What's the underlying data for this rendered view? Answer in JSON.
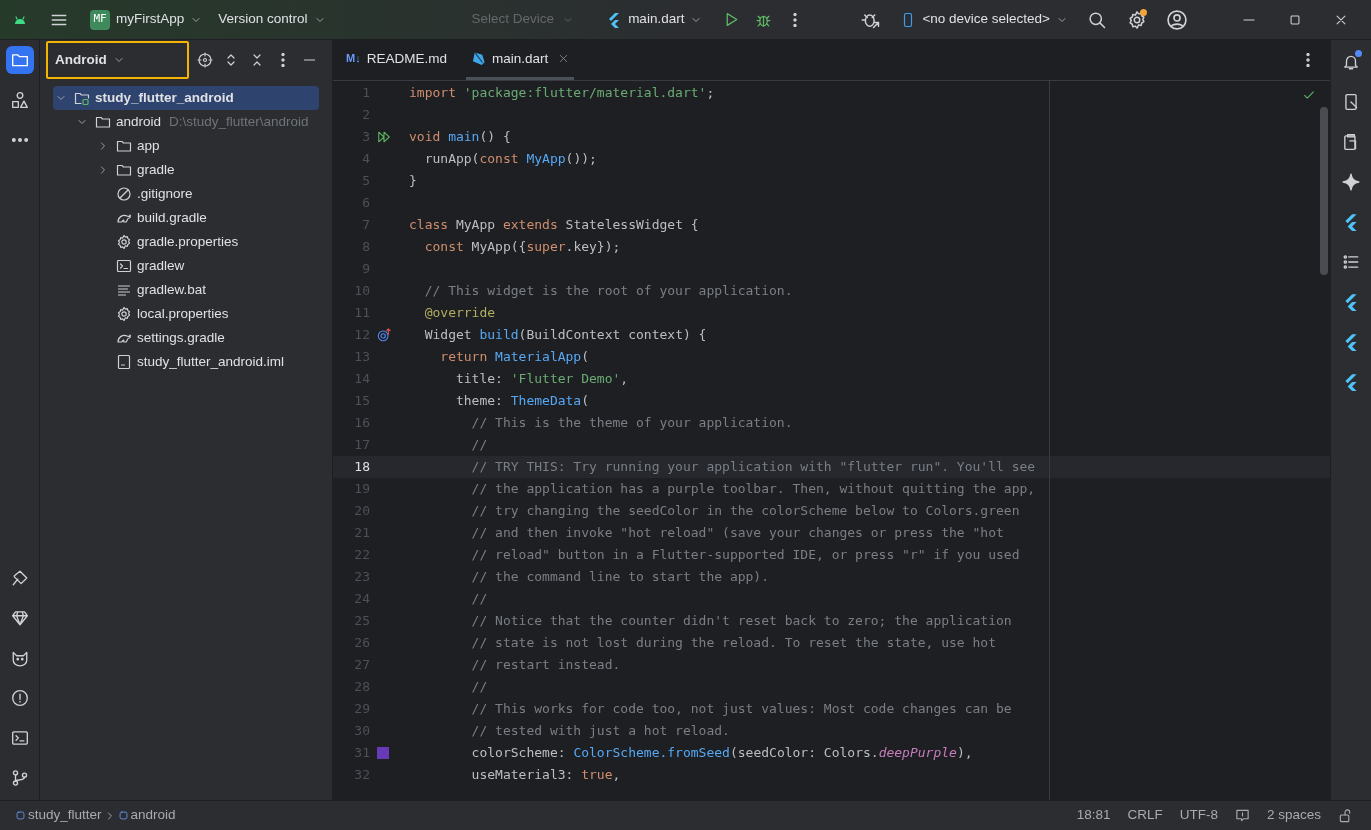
{
  "title_bar": {
    "project_badge": "MF",
    "project": "myFirstApp",
    "vcs": "Version control",
    "device_placeholder": "Select Device",
    "run_config": "main.dart",
    "device": "<no device selected>",
    "settings_badge": true
  },
  "tool_strip_left": {
    "top": [
      {
        "kind": "project",
        "selected": true
      },
      {
        "kind": "structure",
        "selected": false
      },
      {
        "kind": "more",
        "selected": false
      }
    ],
    "bottom": [
      {
        "kind": "build"
      },
      {
        "kind": "gem"
      },
      {
        "kind": "cat"
      },
      {
        "kind": "problems"
      },
      {
        "kind": "terminal"
      },
      {
        "kind": "git"
      }
    ]
  },
  "project_panel": {
    "view": "Android",
    "view_focused": true,
    "tree": [
      {
        "label": "study_flutter_android",
        "kind": "module",
        "expanded": true,
        "selected": true,
        "children": [
          {
            "label": "android",
            "hint": "D:\\study_flutter\\android",
            "kind": "folder",
            "expanded": true,
            "selected": false,
            "children": [
              {
                "label": "app",
                "kind": "folder",
                "expanded": false,
                "selected": false
              },
              {
                "label": "gradle",
                "kind": "folder",
                "expanded": false,
                "selected": false
              },
              {
                "label": ".gitignore",
                "kind": "ignore",
                "selected": false
              },
              {
                "label": "build.gradle",
                "kind": "gradle",
                "selected": false
              },
              {
                "label": "gradle.properties",
                "kind": "settings",
                "selected": false
              },
              {
                "label": "gradlew",
                "kind": "terminal",
                "selected": false
              },
              {
                "label": "gradlew.bat",
                "kind": "text",
                "selected": false
              },
              {
                "label": "local.properties",
                "kind": "settings",
                "selected": false
              },
              {
                "label": "settings.gradle",
                "kind": "gradle",
                "selected": false
              },
              {
                "label": "study_flutter_android.iml",
                "kind": "iml",
                "selected": false
              }
            ]
          }
        ]
      }
    ]
  },
  "editor": {
    "tabs": [
      {
        "label": "README.md",
        "kind": "markdown",
        "icon_text": "M↓",
        "selected": false
      },
      {
        "label": "main.dart",
        "kind": "dart",
        "selected": true,
        "closable": true
      }
    ],
    "lines": [
      {
        "number": "1",
        "current": false,
        "tokens": [
          {
            "kind": "kw",
            "text": "import"
          },
          {
            "kind": "str",
            "text": " 'package:flutter/material.dart'"
          },
          {
            "kind": "p",
            "text": ";"
          }
        ]
      },
      {
        "number": "2",
        "current": false
      },
      {
        "number": "3",
        "current": false,
        "gutter": {
          "kind": "run"
        },
        "tokens": [
          {
            "kind": "kw",
            "text": "void"
          },
          {
            "kind": "fn",
            "text": " main"
          },
          {
            "kind": "p",
            "text": "() {"
          }
        ]
      },
      {
        "number": "4",
        "current": false,
        "tokens": [
          {
            "kind": "p",
            "text": "  runApp("
          },
          {
            "kind": "kw",
            "text": "const"
          },
          {
            "kind": "type",
            "text": " MyApp"
          },
          {
            "kind": "p",
            "text": "());"
          }
        ]
      },
      {
        "number": "5",
        "current": false,
        "tokens": [
          {
            "kind": "p",
            "text": "}"
          }
        ]
      },
      {
        "number": "6",
        "current": false
      },
      {
        "number": "7",
        "current": false,
        "tokens": [
          {
            "kind": "kw",
            "text": "class"
          },
          {
            "kind": "p",
            "text": " MyApp "
          },
          {
            "kind": "kw",
            "text": "extends"
          },
          {
            "kind": "p",
            "text": " StatelessWidget {"
          }
        ]
      },
      {
        "number": "8",
        "current": false,
        "tokens": [
          {
            "kind": "kw",
            "text": "  const"
          },
          {
            "kind": "p",
            "text": " MyApp({"
          },
          {
            "kind": "kw",
            "text": "super"
          },
          {
            "kind": "p",
            "text": ".key});"
          }
        ]
      },
      {
        "number": "9",
        "current": false
      },
      {
        "number": "10",
        "current": false,
        "tokens": [
          {
            "kind": "cmt",
            "text": "  // This widget is the root of your application."
          }
        ]
      },
      {
        "number": "11",
        "current": false,
        "tokens": [
          {
            "kind": "ann",
            "text": "  @override"
          }
        ]
      },
      {
        "number": "12",
        "current": false,
        "gutter": {
          "kind": "override"
        },
        "tokens": [
          {
            "kind": "p",
            "text": "  Widget "
          },
          {
            "kind": "fn",
            "text": "build"
          },
          {
            "kind": "p",
            "text": "(BuildContext context) {"
          }
        ]
      },
      {
        "number": "13",
        "current": false,
        "tokens": [
          {
            "kind": "kw",
            "text": "    return"
          },
          {
            "kind": "type",
            "text": " MaterialApp"
          },
          {
            "kind": "p",
            "text": "("
          }
        ]
      },
      {
        "number": "14",
        "current": false,
        "tokens": [
          {
            "kind": "p",
            "text": "      title: "
          },
          {
            "kind": "str",
            "text": "'Flutter Demo'"
          },
          {
            "kind": "p",
            "text": ","
          }
        ]
      },
      {
        "number": "15",
        "current": false,
        "tokens": [
          {
            "kind": "p",
            "text": "      theme: "
          },
          {
            "kind": "type",
            "text": "ThemeData"
          },
          {
            "kind": "p",
            "text": "("
          }
        ]
      },
      {
        "number": "16",
        "current": false,
        "tokens": [
          {
            "kind": "cmt",
            "text": "        // This is the theme of your application."
          }
        ]
      },
      {
        "number": "17",
        "current": false,
        "tokens": [
          {
            "kind": "cmt",
            "text": "        //"
          }
        ]
      },
      {
        "number": "18",
        "current": true,
        "tokens": [
          {
            "kind": "cmt",
            "text": "        // TRY THIS: Try running your application with \"flutter run\". You'll see"
          }
        ]
      },
      {
        "number": "19",
        "current": false,
        "tokens": [
          {
            "kind": "cmt",
            "text": "        // the application has a purple toolbar. Then, without quitting the app,"
          }
        ]
      },
      {
        "number": "20",
        "current": false,
        "tokens": [
          {
            "kind": "cmt",
            "text": "        // try changing the seedColor in the colorScheme below to Colors.green"
          }
        ]
      },
      {
        "number": "21",
        "current": false,
        "tokens": [
          {
            "kind": "cmt",
            "text": "        // and then invoke \"hot reload\" (save your changes or press the \"hot"
          }
        ]
      },
      {
        "number": "22",
        "current": false,
        "tokens": [
          {
            "kind": "cmt",
            "text": "        // reload\" button in a Flutter-supported IDE, or press \"r\" if you used"
          }
        ]
      },
      {
        "number": "23",
        "current": false,
        "tokens": [
          {
            "kind": "cmt",
            "text": "        // the command line to start the app)."
          }
        ]
      },
      {
        "number": "24",
        "current": false,
        "tokens": [
          {
            "kind": "cmt",
            "text": "        //"
          }
        ]
      },
      {
        "number": "25",
        "current": false,
        "tokens": [
          {
            "kind": "cmt",
            "text": "        // Notice that the counter didn't reset back to zero; the application"
          }
        ]
      },
      {
        "number": "26",
        "current": false,
        "tokens": [
          {
            "kind": "cmt",
            "text": "        // state is not lost during the reload. To reset the state, use hot"
          }
        ]
      },
      {
        "number": "27",
        "current": false,
        "tokens": [
          {
            "kind": "cmt",
            "text": "        // restart instead."
          }
        ]
      },
      {
        "number": "28",
        "current": false,
        "tokens": [
          {
            "kind": "cmt",
            "text": "        //"
          }
        ]
      },
      {
        "number": "29",
        "current": false,
        "tokens": [
          {
            "kind": "cmt",
            "text": "        // This works for code too, not just values: Most code changes can be"
          }
        ]
      },
      {
        "number": "30",
        "current": false,
        "tokens": [
          {
            "kind": "cmt",
            "text": "        // tested with just a hot reload."
          }
        ]
      },
      {
        "number": "31",
        "current": false,
        "gutter": {
          "kind": "color",
          "color": "#673ab7"
        },
        "tokens": [
          {
            "kind": "p",
            "text": "        colorScheme: "
          },
          {
            "kind": "type",
            "text": "ColorScheme"
          },
          {
            "kind": "fn",
            "text": ".fromSeed"
          },
          {
            "kind": "p",
            "text": "(seedColor: Colors."
          },
          {
            "kind": "field",
            "text": "deepPurple"
          },
          {
            "kind": "p",
            "text": "),"
          }
        ]
      },
      {
        "number": "32",
        "current": false,
        "tokens": [
          {
            "kind": "p",
            "text": "        useMaterial3: "
          },
          {
            "kind": "kw",
            "text": "true"
          },
          {
            "kind": "p",
            "text": ","
          }
        ]
      }
    ]
  },
  "tool_strip_right": [
    {
      "kind": "bell",
      "badge": true
    },
    {
      "kind": "device"
    },
    {
      "kind": "clipboard"
    },
    {
      "kind": "sparkle"
    },
    {
      "kind": "flutter"
    },
    {
      "kind": "list"
    },
    {
      "kind": "flutter"
    },
    {
      "kind": "flutter"
    },
    {
      "kind": "flutter"
    }
  ],
  "status_bar": {
    "breadcrumbs": [
      "study_flutter",
      "android"
    ],
    "position": "18:81",
    "line_ending": "CRLF",
    "encoding": "UTF-8",
    "indent": "2 spaces"
  }
}
